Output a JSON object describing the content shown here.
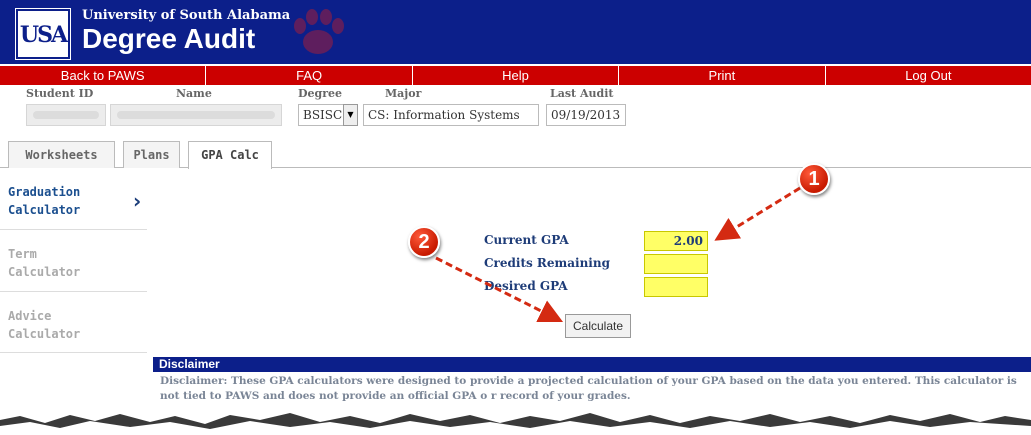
{
  "header": {
    "logo_text": "USA",
    "university": "University of South Alabama",
    "title": "Degree Audit",
    "brand_color": "#0c1f8a"
  },
  "nav": {
    "color": "#cc0000",
    "items": [
      "Back to PAWS",
      "FAQ",
      "Help",
      "Print",
      "Log Out"
    ]
  },
  "student": {
    "labels": {
      "student_id": "Student ID",
      "name": "Name",
      "degree": "Degree",
      "major": "Major",
      "last_audit": "Last Audit"
    },
    "degree": "BSISC",
    "major": "CS: Information Systems",
    "last_audit": "09/19/2013"
  },
  "tabs": [
    "Worksheets",
    "Plans",
    "GPA Calc"
  ],
  "active_tab": "GPA Calc",
  "sidebar": {
    "items": [
      {
        "line1": "Graduation",
        "line2": "Calculator",
        "active": true
      },
      {
        "line1": "Term",
        "line2": "Calculator",
        "active": false
      },
      {
        "line1": "Advice",
        "line2": "Calculator",
        "active": false
      }
    ],
    "chevron_icon": "chevron-right-icon"
  },
  "form": {
    "fields": [
      {
        "label": "Current GPA",
        "value": "2.00"
      },
      {
        "label": "Credits Remaining",
        "value": ""
      },
      {
        "label": "Desired GPA",
        "value": ""
      }
    ],
    "input_color": "#ffff66",
    "button_label": "Calculate"
  },
  "disclaimer": {
    "title": "Disclaimer",
    "text": "Disclaimer: These GPA calculators were designed to provide a projected calculation of your GPA based on the data you entered. This calculator is not tied to PAWS and does not provide an official GPA o r record of your grades."
  },
  "annotations": {
    "badge1": "1",
    "badge2": "2",
    "color": "#d42a12"
  }
}
